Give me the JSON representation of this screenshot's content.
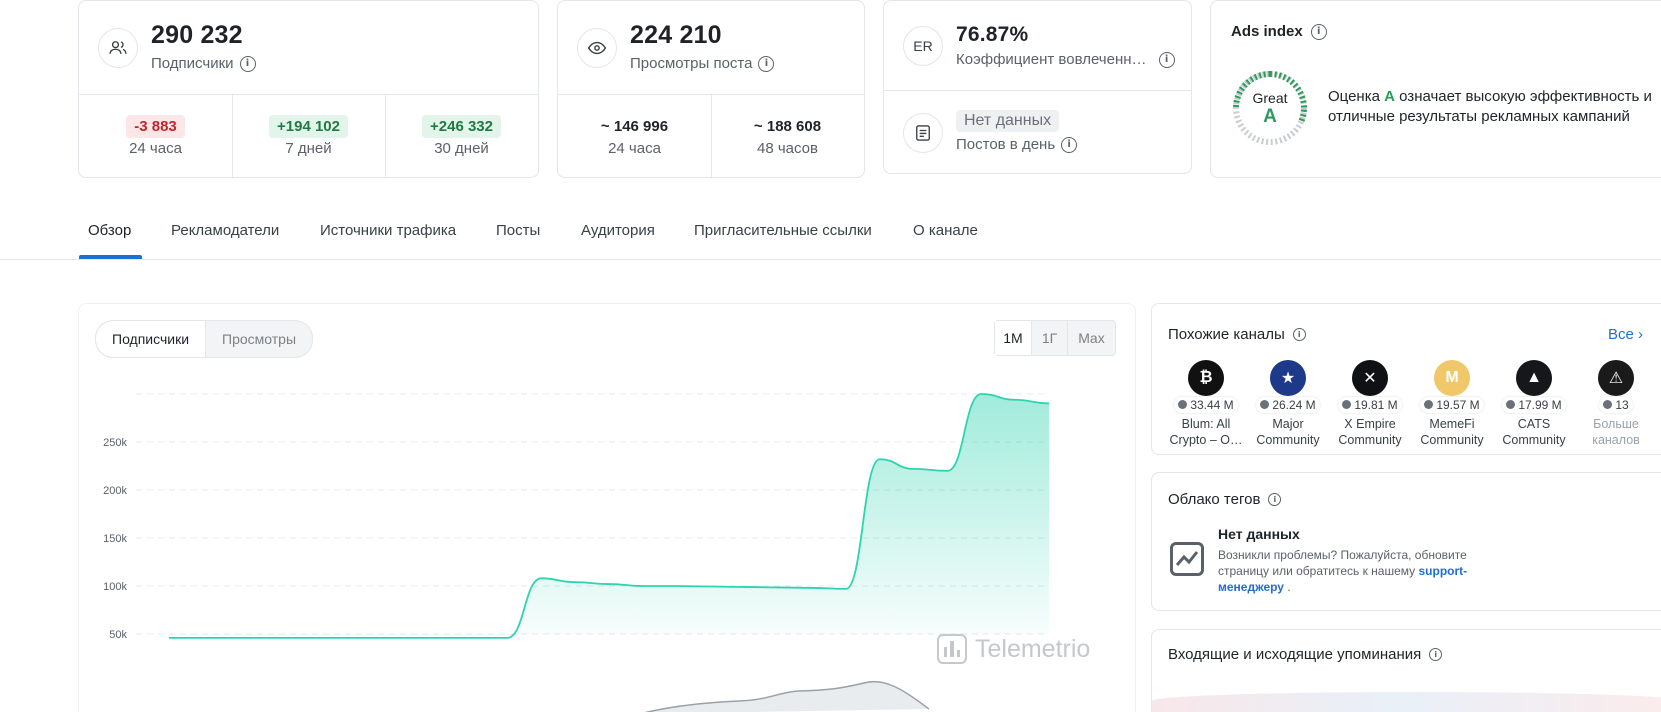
{
  "stats": {
    "subscribers": {
      "value": "290 232",
      "label": "Подписчики",
      "deltas": [
        {
          "value": "-3 883",
          "period": "24 часа",
          "kind": "neg"
        },
        {
          "value": "+194 102",
          "period": "7 дней",
          "kind": "pos"
        },
        {
          "value": "+246 332",
          "period": "30 дней",
          "kind": "pos"
        }
      ]
    },
    "views": {
      "value": "224 210",
      "label": "Просмотры поста",
      "periods": [
        {
          "value": "~ 146 996",
          "period": "24 часа"
        },
        {
          "value": "~ 188 608",
          "period": "48 часов"
        }
      ]
    },
    "er": {
      "icon_text": "ER",
      "value": "76.87%",
      "label": "Коэффициент вовлеченн…",
      "posts_value": "Нет данных",
      "posts_label": "Постов в день"
    },
    "ads": {
      "title": "Ads index",
      "grade_word": "Great",
      "grade_letter": "A",
      "desc_prefix": "Оценка ",
      "desc_grade": "A",
      "desc_rest": " означает высокую эффективность и отличные результаты рекламных кампаний"
    }
  },
  "tabs": [
    "Обзор",
    "Рекламодатели",
    "Источники трафика",
    "Посты",
    "Аудитория",
    "Пригласительные ссылки",
    "О канале"
  ],
  "chart_panel": {
    "toggle": [
      "Подписчики",
      "Просмотры"
    ],
    "ranges": [
      "1М",
      "1Г",
      "Max"
    ],
    "watermark": "Telemetrio"
  },
  "chart_data": {
    "type": "area",
    "series": [
      {
        "name": "Подписчики",
        "values": [
          46000,
          46000,
          46000,
          46000,
          46000,
          46000,
          46000,
          46000,
          46000,
          46000,
          46000,
          108000,
          104000,
          102000,
          100000,
          100000,
          99500,
          99000,
          98500,
          98000,
          97000,
          232000,
          222000,
          220000,
          300000,
          294000,
          290232
        ]
      }
    ],
    "y_ticks": [
      "250k",
      "200k",
      "150k",
      "100k",
      "50k"
    ],
    "ylim": [
      50000,
      300000
    ],
    "grid": true,
    "color": "#2ed3b0"
  },
  "similar": {
    "title": "Похожие каналы",
    "all_link": "Все",
    "channels": [
      {
        "count": "33.44 M",
        "name": "Blum: All Crypto – O…",
        "color": "#111111",
        "glyph": "₿"
      },
      {
        "count": "26.24 M",
        "name": "Major Community",
        "color": "#1d3a8a",
        "glyph": "★"
      },
      {
        "count": "19.81 M",
        "name": "X Empire Community",
        "color": "#0f1115",
        "glyph": "✕"
      },
      {
        "count": "19.57 M",
        "name": "MemeFi Community",
        "color": "#f0c86a",
        "glyph": "M"
      },
      {
        "count": "17.99 M",
        "name": "CATS Community",
        "color": "#15171b",
        "glyph": "▲"
      },
      {
        "count": "13",
        "name": "Больше каналов",
        "color": "#1a1a1a",
        "glyph": "⚠"
      }
    ]
  },
  "tags": {
    "title": "Облако тегов",
    "empty_title": "Нет данных",
    "empty_text": "Возникли проблемы? Пожалуйста, обновите страницу или обратитесь к нашему",
    "support_link": "support-менеджеру",
    "tail": "."
  },
  "mentions": {
    "title": "Входящие и исходящие упоминания"
  }
}
